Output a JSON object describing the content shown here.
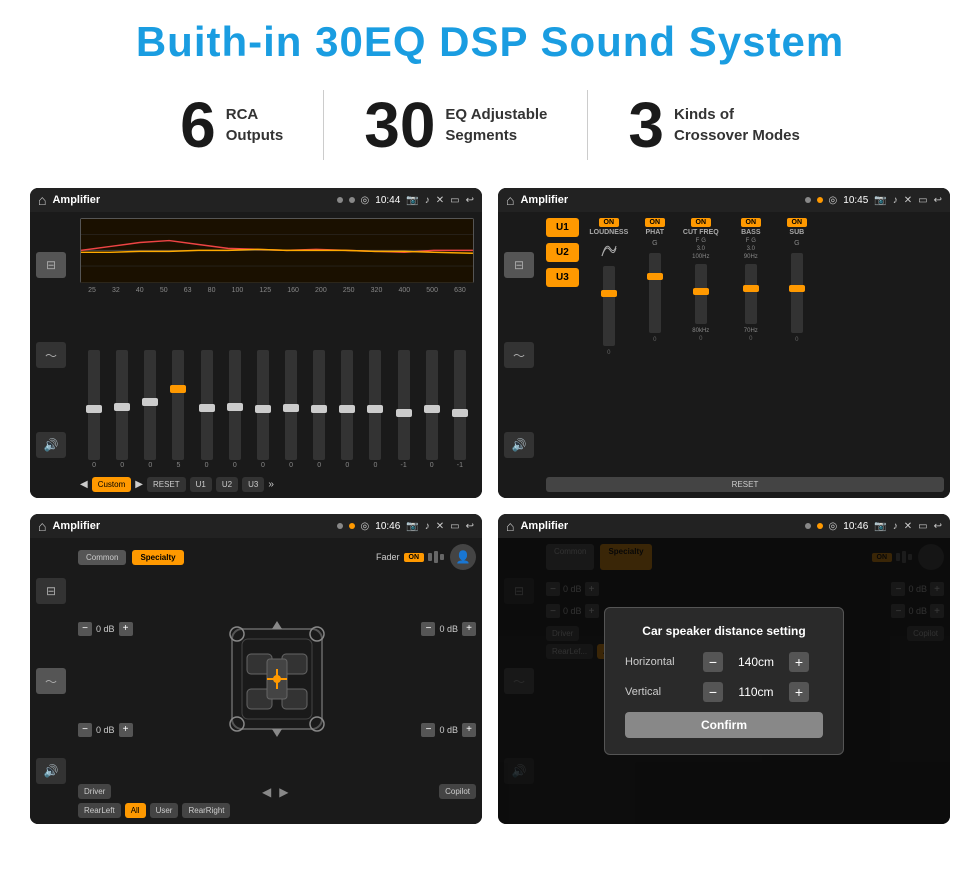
{
  "page": {
    "title": "Buith-in 30EQ DSP Sound System"
  },
  "features": [
    {
      "number": "6",
      "line1": "RCA",
      "line2": "Outputs"
    },
    {
      "number": "30",
      "line1": "EQ Adjustable",
      "line2": "Segments"
    },
    {
      "number": "3",
      "line1": "Kinds of",
      "line2": "Crossover Modes"
    }
  ],
  "screens": [
    {
      "id": "screen1",
      "title": "Amplifier",
      "time": "10:44",
      "description": "EQ equalizer screen"
    },
    {
      "id": "screen2",
      "title": "Amplifier",
      "time": "10:45",
      "description": "Channel amplifier screen"
    },
    {
      "id": "screen3",
      "title": "Amplifier",
      "time": "10:46",
      "description": "Speaker fader screen"
    },
    {
      "id": "screen4",
      "title": "Amplifier",
      "time": "10:46",
      "description": "Distance setting dialog"
    }
  ],
  "eq": {
    "presets": [
      "Custom",
      "RESET",
      "U1",
      "U2",
      "U3"
    ],
    "freq_labels": [
      "25",
      "32",
      "40",
      "50",
      "63",
      "80",
      "100",
      "125",
      "160",
      "200",
      "250",
      "320",
      "400",
      "500",
      "630"
    ],
    "values": [
      "0",
      "0",
      "0",
      "5",
      "0",
      "0",
      "0",
      "0",
      "0",
      "0",
      "0",
      "-1",
      "0",
      "-1"
    ]
  },
  "amp": {
    "channels": [
      "LOUDNESS",
      "PHAT",
      "CUT FREQ",
      "BASS",
      "SUB"
    ],
    "u_buttons": [
      "U1",
      "U2",
      "U3"
    ],
    "reset_label": "RESET"
  },
  "speaker": {
    "common_label": "Common",
    "specialty_label": "Specialty",
    "fader_label": "Fader",
    "on_label": "ON",
    "driver_label": "Driver",
    "copilot_label": "Copilot",
    "rear_left_label": "RearLeft",
    "all_label": "All",
    "user_label": "User",
    "rear_right_label": "RearRight",
    "db_values": [
      "0 dB",
      "0 dB",
      "0 dB",
      "0 dB"
    ]
  },
  "dialog": {
    "title": "Car speaker distance setting",
    "horizontal_label": "Horizontal",
    "horizontal_value": "140cm",
    "vertical_label": "Vertical",
    "vertical_value": "110cm",
    "confirm_label": "Confirm"
  }
}
